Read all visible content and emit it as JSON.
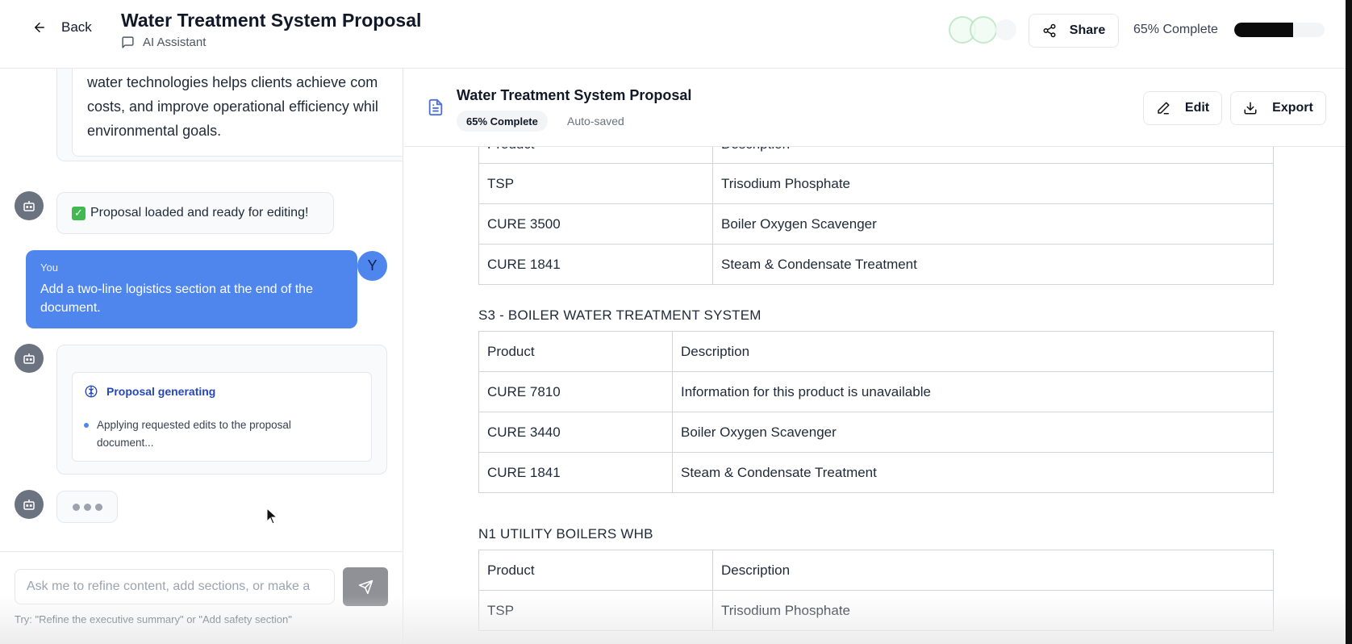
{
  "header": {
    "back_label": "Back",
    "title": "Water Treatment System Proposal",
    "subtitle": "AI Assistant",
    "share_label": "Share",
    "progress_text": "65% Complete",
    "progress_fraction": 0.65
  },
  "chat": {
    "prev_message_lines": [
      "water technologies helps clients achieve com",
      "costs, and improve operational efficiency whil",
      "environmental goals."
    ],
    "loaded_message": "Proposal loaded and ready for editing!",
    "user": {
      "who": "You",
      "avatar_letter": "Y",
      "text": "Add a two-line logistics section at the end of the document."
    },
    "generating": {
      "title": "Proposal generating",
      "item": "Applying requested edits to the proposal document..."
    },
    "input_placeholder": "Ask me to refine content, add sections, or make a",
    "hint": "Try: \"Refine the executive summary\" or \"Add safety section\""
  },
  "document": {
    "title": "Water Treatment System Proposal",
    "badge": "65% Complete",
    "saved": "Auto-saved",
    "edit_label": "Edit",
    "export_label": "Export",
    "table_top": {
      "header": [
        "Product",
        "Description"
      ],
      "rows": [
        [
          "TSP",
          "Trisodium Phosphate"
        ],
        [
          "CURE 3500",
          "Boiler Oxygen Scavenger"
        ],
        [
          "CURE 1841",
          "Steam & Condensate Treatment"
        ]
      ]
    },
    "section_s3": {
      "title": "S3 - BOILER WATER TREATMENT SYSTEM",
      "header": [
        "Product",
        "Description"
      ],
      "rows": [
        [
          "CURE 7810",
          "Information for this product is unavailable"
        ],
        [
          "CURE 3440",
          "Boiler Oxygen Scavenger"
        ],
        [
          "CURE 1841",
          "Steam & Condensate Treatment"
        ]
      ]
    },
    "section_n1": {
      "title": "N1 UTILITY BOILERS WHB",
      "header": [
        "Product",
        "Description"
      ],
      "rows": [
        [
          "TSP",
          "Trisodium Phosphate"
        ]
      ]
    }
  }
}
